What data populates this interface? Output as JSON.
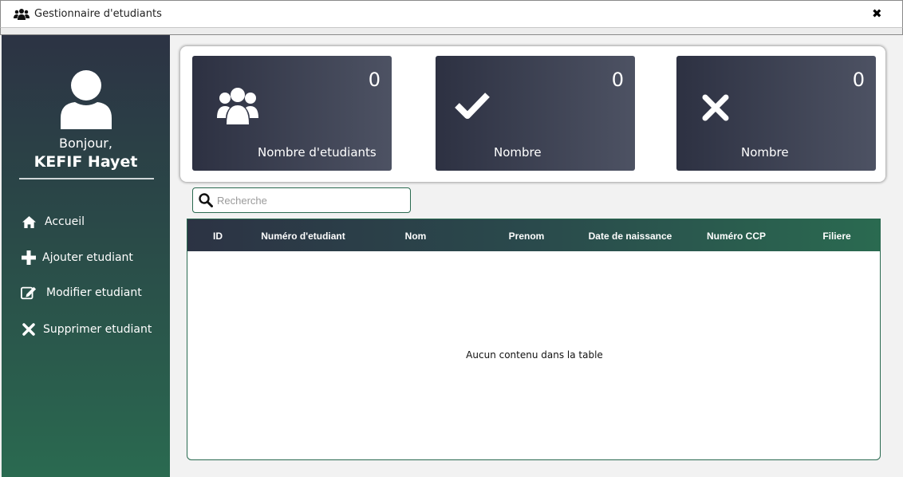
{
  "window": {
    "title": "Gestionnaire d'etudiants",
    "close_symbol": "✖"
  },
  "sidebar": {
    "greeting": "Bonjour,",
    "username": "KEFIF Hayet",
    "items": [
      {
        "label": "Accueil",
        "icon": "home-icon"
      },
      {
        "label": "Ajouter etudiant",
        "icon": "plus-icon"
      },
      {
        "label": "Modifier etudiant",
        "icon": "edit-icon"
      },
      {
        "label": "Supprimer etudiant",
        "icon": "times-icon"
      }
    ]
  },
  "cards": [
    {
      "count": "0",
      "label": "Nombre d'etudiants",
      "icon": "users-icon"
    },
    {
      "count": "0",
      "label": "Nombre",
      "icon": "check-icon"
    },
    {
      "count": "0",
      "label": "Nombre",
      "icon": "times-icon"
    }
  ],
  "search": {
    "placeholder": "Recherche",
    "value": ""
  },
  "table": {
    "columns": [
      "ID",
      "Numéro d'etudiant",
      "Nom",
      "Prenom",
      "Date de naissance",
      "Numéro CCP",
      "Filiere"
    ],
    "empty_message": "Aucun contenu dans la table"
  },
  "colors": {
    "sidebar_top": "#2c3344",
    "sidebar_bottom": "#2a6a50",
    "card_start": "#2d3142",
    "card_end": "#4d5263",
    "accent_green": "#2a6a50"
  }
}
